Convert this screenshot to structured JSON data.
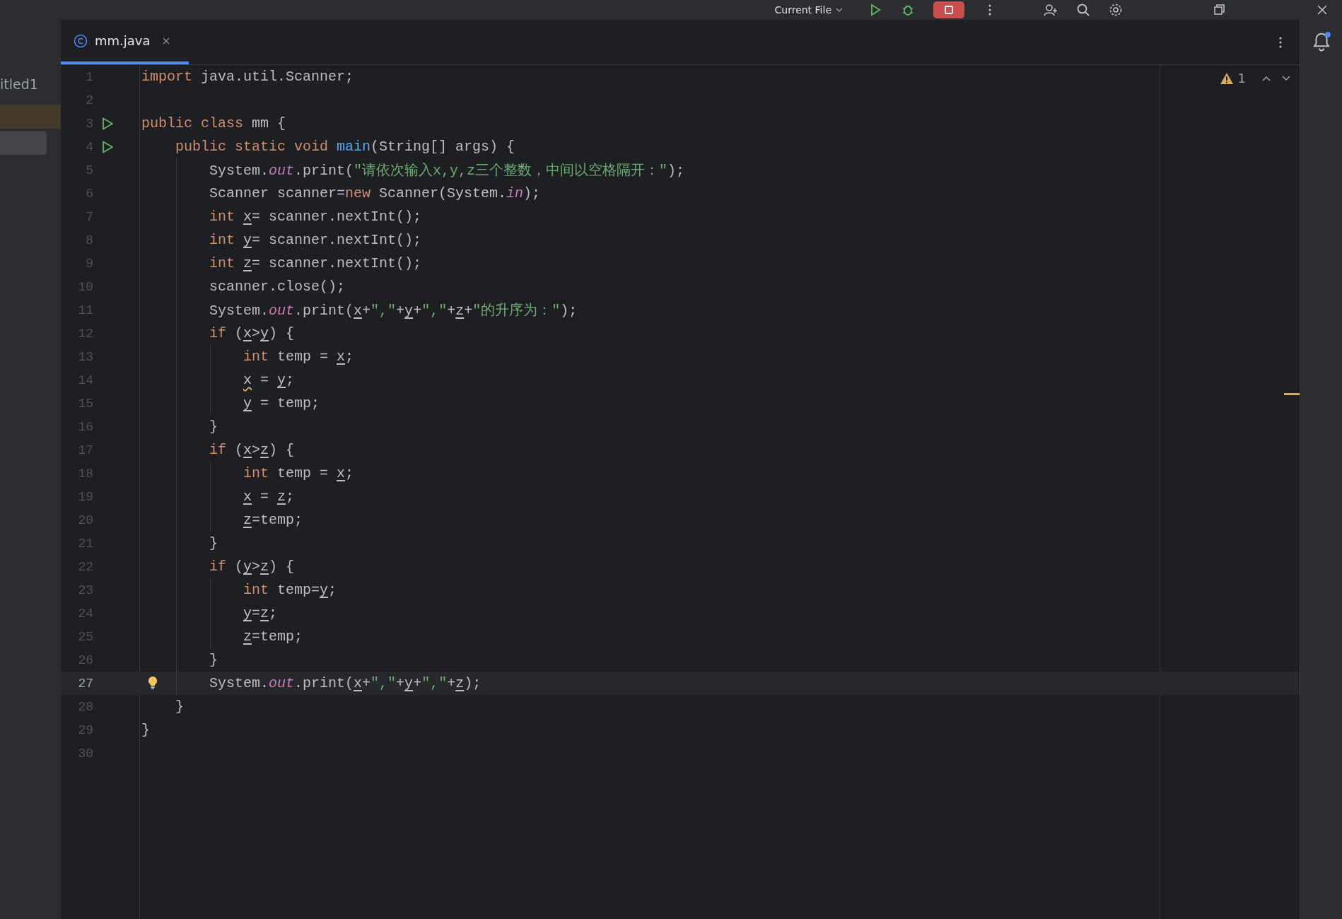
{
  "toolbar": {
    "run_config": "Current File"
  },
  "project_panel": {
    "items": [
      {
        "label": "itled1"
      }
    ]
  },
  "tabs": [
    {
      "label": "mm.java",
      "selected": true
    }
  ],
  "inspections": {
    "warnings": "1"
  },
  "editor": {
    "lines": [
      {
        "number": "1",
        "tokens": [
          {
            "kind": "keyword",
            "text": "import"
          },
          {
            "kind": "plain",
            "text": " java.util.Scanner;"
          }
        ]
      },
      {
        "number": "2"
      },
      {
        "number": "3",
        "kind": "run",
        "tokens": [
          {
            "kind": "keyword",
            "text": "public class"
          },
          {
            "kind": "plain",
            "text": " mm {"
          }
        ]
      },
      {
        "number": "4",
        "kind": "run",
        "tokens": [
          {
            "kind": "keyword",
            "text": "    public static void"
          },
          {
            "kind": "method_decl",
            "text": " main"
          },
          {
            "kind": "plain",
            "text": "(String[] args) {"
          }
        ]
      },
      {
        "number": "5",
        "tokens": [
          {
            "kind": "plain",
            "text": "        System."
          },
          {
            "kind": "static_field",
            "text": "out"
          },
          {
            "kind": "plain",
            "text": ".print("
          },
          {
            "kind": "string",
            "text": "\"请依次输入x,y,z三个整数，中间以空格隔开：\""
          },
          {
            "kind": "plain",
            "text": ");"
          }
        ]
      },
      {
        "number": "6",
        "tokens": [
          {
            "kind": "plain",
            "text": "        Scanner scanner="
          },
          {
            "kind": "keyword",
            "text": "new"
          },
          {
            "kind": "plain",
            "text": " Scanner(System."
          },
          {
            "kind": "static_field",
            "text": "in"
          },
          {
            "kind": "plain",
            "text": ");"
          }
        ]
      },
      {
        "number": "7",
        "tokens": [
          {
            "kind": "keyword",
            "text": "        int"
          },
          {
            "kind": "reassigned_var",
            "text": " x"
          },
          {
            "kind": "plain",
            "text": "= scanner.nextInt();"
          }
        ]
      },
      {
        "number": "8",
        "tokens": [
          {
            "kind": "keyword",
            "text": "        int"
          },
          {
            "kind": "reassigned_var",
            "text": " y"
          },
          {
            "kind": "plain",
            "text": "= scanner.nextInt();"
          }
        ]
      },
      {
        "number": "9",
        "tokens": [
          {
            "kind": "keyword",
            "text": "        int"
          },
          {
            "kind": "reassigned_var",
            "text": " z"
          },
          {
            "kind": "plain",
            "text": "= scanner.nextInt();"
          }
        ]
      },
      {
        "number": "10",
        "tokens": [
          {
            "kind": "plain",
            "text": "        scanner.close();"
          }
        ]
      },
      {
        "number": "11",
        "tokens": [
          {
            "kind": "plain",
            "text": "        System."
          },
          {
            "kind": "static_field",
            "text": "out"
          },
          {
            "kind": "plain",
            "text": ".print("
          },
          {
            "kind": "reassigned_var",
            "text": "x"
          },
          {
            "kind": "plain",
            "text": "+"
          },
          {
            "kind": "string",
            "text": "\",\""
          },
          {
            "kind": "plain",
            "text": "+"
          },
          {
            "kind": "reassigned_var",
            "text": "y"
          },
          {
            "kind": "plain",
            "text": "+"
          },
          {
            "kind": "string",
            "text": "\",\""
          },
          {
            "kind": "plain",
            "text": "+"
          },
          {
            "kind": "reassigned_var",
            "text": "z"
          },
          {
            "kind": "plain",
            "text": "+"
          },
          {
            "kind": "string",
            "text": "\"的升序为：\""
          },
          {
            "kind": "plain",
            "text": ");"
          }
        ]
      },
      {
        "number": "12",
        "tokens": [
          {
            "kind": "keyword",
            "text": "        if"
          },
          {
            "kind": "plain",
            "text": " ("
          },
          {
            "kind": "reassigned_var",
            "text": "x"
          },
          {
            "kind": "plain",
            "text": ">"
          },
          {
            "kind": "reassigned_var",
            "text": "y"
          },
          {
            "kind": "plain",
            "text": ") {"
          }
        ]
      },
      {
        "number": "13",
        "tokens": [
          {
            "kind": "keyword",
            "text": "            int"
          },
          {
            "kind": "plain",
            "text": " temp = "
          },
          {
            "kind": "reassigned_var",
            "text": "x"
          },
          {
            "kind": "plain",
            "text": ";"
          }
        ]
      },
      {
        "number": "14",
        "tokens": [
          {
            "kind": "warned_var",
            "text": "            x"
          },
          {
            "kind": "plain",
            "text": " = "
          },
          {
            "kind": "reassigned_var",
            "text": "y"
          },
          {
            "kind": "plain",
            "text": ";"
          }
        ]
      },
      {
        "number": "15",
        "tokens": [
          {
            "kind": "reassigned_var",
            "text": "            y"
          },
          {
            "kind": "plain",
            "text": " = temp;"
          }
        ]
      },
      {
        "number": "16",
        "tokens": [
          {
            "kind": "plain",
            "text": "        }"
          }
        ]
      },
      {
        "number": "17",
        "tokens": [
          {
            "kind": "keyword",
            "text": "        if"
          },
          {
            "kind": "plain",
            "text": " ("
          },
          {
            "kind": "reassigned_var",
            "text": "x"
          },
          {
            "kind": "plain",
            "text": ">"
          },
          {
            "kind": "reassigned_var",
            "text": "z"
          },
          {
            "kind": "plain",
            "text": ") {"
          }
        ]
      },
      {
        "number": "18",
        "tokens": [
          {
            "kind": "keyword",
            "text": "            int"
          },
          {
            "kind": "plain",
            "text": " temp = "
          },
          {
            "kind": "reassigned_var",
            "text": "x"
          },
          {
            "kind": "plain",
            "text": ";"
          }
        ]
      },
      {
        "number": "19",
        "tokens": [
          {
            "kind": "reassigned_var",
            "text": "            x"
          },
          {
            "kind": "plain",
            "text": " = "
          },
          {
            "kind": "reassigned_var",
            "text": "z"
          },
          {
            "kind": "plain",
            "text": ";"
          }
        ]
      },
      {
        "number": "20",
        "tokens": [
          {
            "kind": "reassigned_var",
            "text": "            z"
          },
          {
            "kind": "plain",
            "text": "=temp;"
          }
        ]
      },
      {
        "number": "21",
        "tokens": [
          {
            "kind": "plain",
            "text": "        }"
          }
        ]
      },
      {
        "number": "22",
        "tokens": [
          {
            "kind": "keyword",
            "text": "        if"
          },
          {
            "kind": "plain",
            "text": " ("
          },
          {
            "kind": "reassigned_var",
            "text": "y"
          },
          {
            "kind": "plain",
            "text": ">"
          },
          {
            "kind": "reassigned_var",
            "text": "z"
          },
          {
            "kind": "plain",
            "text": ") {"
          }
        ]
      },
      {
        "number": "23",
        "tokens": [
          {
            "kind": "keyword",
            "text": "            int"
          },
          {
            "kind": "plain",
            "text": " temp="
          },
          {
            "kind": "reassigned_var",
            "text": "y"
          },
          {
            "kind": "plain",
            "text": ";"
          }
        ]
      },
      {
        "number": "24",
        "tokens": [
          {
            "kind": "reassigned_var",
            "text": "            y"
          },
          {
            "kind": "plain",
            "text": "="
          },
          {
            "kind": "reassigned_var",
            "text": "z"
          },
          {
            "kind": "plain",
            "text": ";"
          }
        ]
      },
      {
        "number": "25",
        "tokens": [
          {
            "kind": "reassigned_var",
            "text": "            z"
          },
          {
            "kind": "plain",
            "text": "=temp;"
          }
        ]
      },
      {
        "number": "26",
        "tokens": [
          {
            "kind": "plain",
            "text": "        }"
          }
        ]
      },
      {
        "number": "27",
        "current": true,
        "kind": "bulb",
        "tokens": [
          {
            "kind": "plain",
            "text": "        System."
          },
          {
            "kind": "static_field",
            "text": "out"
          },
          {
            "kind": "plain",
            "text": ".print("
          },
          {
            "kind": "reassigned_var",
            "text": "x"
          },
          {
            "kind": "plain",
            "text": "+"
          },
          {
            "kind": "string",
            "text": "\",\""
          },
          {
            "kind": "plain",
            "text": "+"
          },
          {
            "kind": "reassigned_var",
            "text": "y"
          },
          {
            "kind": "plain",
            "text": "+"
          },
          {
            "kind": "string",
            "text": "\",\""
          },
          {
            "kind": "plain",
            "text": "+"
          },
          {
            "kind": "reassigned_var",
            "text": "z"
          },
          {
            "kind": "plain",
            "text": ");"
          }
        ]
      },
      {
        "number": "28",
        "tokens": [
          {
            "kind": "plain",
            "text": "    }"
          }
        ]
      },
      {
        "number": "29",
        "tokens": [
          {
            "kind": "plain",
            "text": "}"
          }
        ]
      },
      {
        "number": "30"
      }
    ]
  }
}
